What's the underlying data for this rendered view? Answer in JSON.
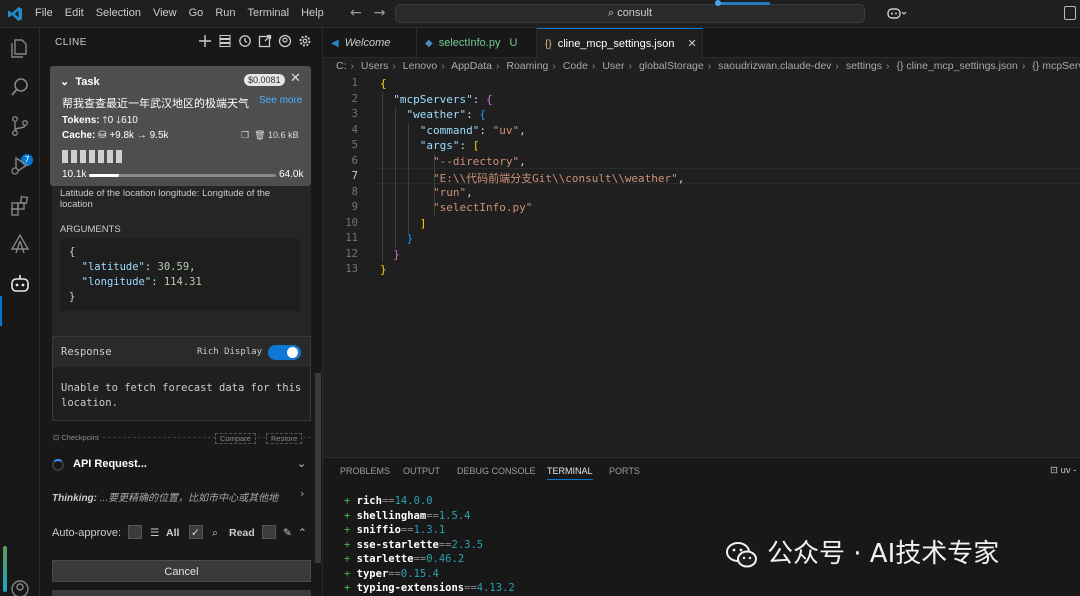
{
  "titlebar": {
    "menu": [
      "File",
      "Edit",
      "Selection",
      "View",
      "Go",
      "Run",
      "Terminal",
      "Help"
    ],
    "search": "consult"
  },
  "activity": {
    "scm_badge": "7"
  },
  "sidebar": {
    "title": "CLINE",
    "task": {
      "label": "Task",
      "cost": "$0.0081",
      "text": "帮我查查最近一年武汉地区的极端天气",
      "see_more": "See more",
      "tokens_label": "Tokens:",
      "tokens_in": "0",
      "tokens_out": "610",
      "cache_label": "Cache:",
      "cache_write": "+9.8k",
      "cache_read": "9.5k",
      "size": "10.6 kB",
      "context_used": "10.1k",
      "context_max": "64.0k",
      "context_fraction": 0.16
    },
    "tool": {
      "description": "Latitude of the location longitude: Longitude of the location",
      "args_label": "ARGUMENTS",
      "latitude": "30.59",
      "longitude": "114.31"
    },
    "response": {
      "title": "Response",
      "rich_display": "Rich Display",
      "text": "Unable to fetch forecast data for this location."
    },
    "checkpoint": {
      "label": "Checkpoint",
      "compare": "Compare",
      "restore": "Restore"
    },
    "api_request": "API Request...",
    "thinking_label": "Thinking:",
    "thinking_text": "...要更精确的位置，比如市中心或其他地",
    "auto_approve": {
      "label": "Auto-approve:",
      "all": "All",
      "read": "Read"
    },
    "cancel": "Cancel"
  },
  "tabs": [
    {
      "label": "Welcome",
      "icon": "vscode-icon"
    },
    {
      "label": "selectInfo.py",
      "suffix": "U",
      "icon": "python-icon"
    },
    {
      "label": "cline_mcp_settings.json",
      "icon": "json-icon",
      "active": true
    }
  ],
  "breadcrumb": [
    "C:",
    "Users",
    "Lenovo",
    "AppData",
    "Roaming",
    "Code",
    "User",
    "globalStorage",
    "saoudrizwan.claude-dev",
    "settings",
    "{} cline_mcp_settings.json",
    "{} mcpServers"
  ],
  "code": {
    "line_numbers": [
      "1",
      "2",
      "3",
      "4",
      "5",
      "6",
      "7",
      "8",
      "9",
      "10",
      "11",
      "12",
      "13"
    ],
    "current_line": "7",
    "k_mcpServers": "\"mcpServers\"",
    "k_weather": "\"weather\"",
    "k_command": "\"command\"",
    "v_command": "\"uv\"",
    "k_args": "\"args\"",
    "a1": "\"--directory\"",
    "a2": "\"E:\\\\代码前端分支Git\\\\consult\\\\weather\"",
    "a3": "\"run\"",
    "a4": "\"selectInfo.py\""
  },
  "panel": {
    "tabs": [
      "PROBLEMS",
      "OUTPUT",
      "DEBUG CONSOLE",
      "TERMINAL",
      "PORTS"
    ],
    "active_tab": "TERMINAL",
    "term_label": "uv -",
    "lines": [
      {
        "name": "rich",
        "version": "14.0.0"
      },
      {
        "name": "shellingham",
        "version": "1.5.4"
      },
      {
        "name": "sniffio",
        "version": "1.3.1"
      },
      {
        "name": "sse-starlette",
        "version": "2.3.5"
      },
      {
        "name": "starlette",
        "version": "0.46.2"
      },
      {
        "name": "typer",
        "version": "0.15.4"
      },
      {
        "name": "typing-extensions",
        "version": "4.13.2"
      }
    ]
  },
  "watermark": "公众号 · AI技术专家"
}
